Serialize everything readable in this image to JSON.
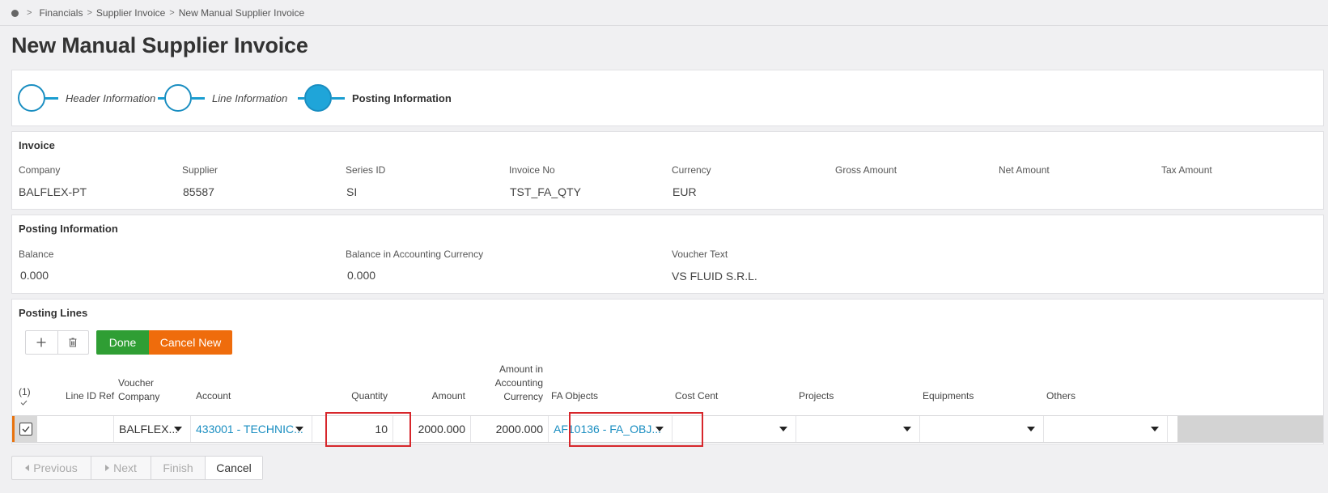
{
  "breadcrumb": {
    "items": [
      "Financials",
      "Supplier Invoice",
      "New Manual Supplier Invoice"
    ]
  },
  "page_title": "New Manual Supplier Invoice",
  "wizard": {
    "steps": [
      {
        "label": "Header Information",
        "state": "inactive"
      },
      {
        "label": "Line Information",
        "state": "inactive"
      },
      {
        "label": "Posting Information",
        "state": "active"
      }
    ]
  },
  "invoice": {
    "title": "Invoice",
    "fields": [
      {
        "label": "Company",
        "value": "BALFLEX-PT"
      },
      {
        "label": "Supplier",
        "value": "85587"
      },
      {
        "label": "Series ID",
        "value": "SI"
      },
      {
        "label": "Invoice No",
        "value": "TST_FA_QTY"
      },
      {
        "label": "Currency",
        "value": "EUR"
      },
      {
        "label": "Gross Amount",
        "value": ""
      },
      {
        "label": "Net Amount",
        "value": ""
      },
      {
        "label": "Tax Amount",
        "value": ""
      }
    ]
  },
  "posting_info": {
    "title": "Posting Information",
    "fields": [
      {
        "label": "Balance",
        "value": "0.000"
      },
      {
        "label": "Balance in Accounting Currency",
        "value": "0.000"
      },
      {
        "label": "Voucher Text",
        "value": "VS FLUID S.R.L."
      }
    ]
  },
  "posting_lines": {
    "title": "Posting Lines",
    "toolbar": {
      "add_icon": "plus-icon",
      "delete_icon": "trash-icon",
      "done_label": "Done",
      "cancel_new_label": "Cancel New"
    },
    "selected_count": "(1)",
    "columns": {
      "line_id_ref": "Line ID Ref",
      "voucher_company_1": "Voucher",
      "voucher_company_2": "Company",
      "account": "Account",
      "quantity": "Quantity",
      "amount": "Amount",
      "amount_acc_1": "Amount in",
      "amount_acc_2": "Accounting",
      "amount_acc_3": "Currency",
      "fa_objects": "FA Objects",
      "cost_center": "Cost Cent",
      "projects": "Projects",
      "equipments": "Equipments",
      "others": "Others"
    },
    "row": {
      "line_id_ref": "",
      "voucher_company": "BALFLEX...",
      "account": "433001 - TECHNIC...",
      "quantity": "10",
      "amount": "2000.000",
      "amount_acc": "2000.000",
      "fa_objects": "AF10136 - FA_OBJ...",
      "cost_center": "",
      "projects": "",
      "equipments": "",
      "others": ""
    }
  },
  "footer": {
    "previous": "Previous",
    "next": "Next",
    "finish": "Finish",
    "cancel": "Cancel"
  },
  "colors": {
    "accent": "#1a8ec1",
    "done": "#2f9e34",
    "cancel_new": "#ef6c0c",
    "highlight": "#d7262b",
    "row_marker": "#e8730f"
  }
}
